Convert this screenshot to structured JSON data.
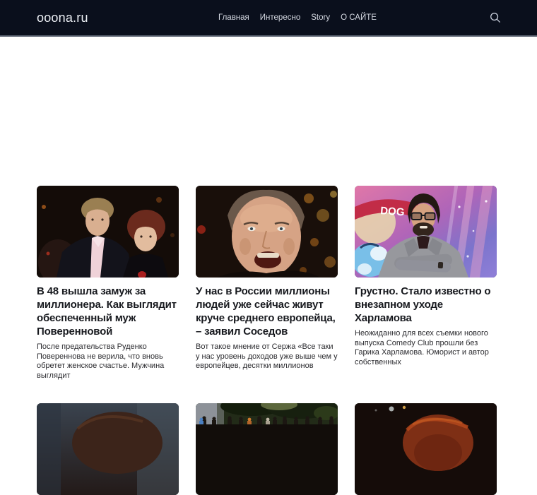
{
  "header": {
    "logo": "ooona.ru",
    "background_color": "#0a0f1c",
    "border_color": "#5c6472",
    "nav_items": [
      {
        "label": "Главная"
      },
      {
        "label": "Интересно"
      },
      {
        "label": "Story"
      },
      {
        "label": "О САЙТЕ"
      }
    ],
    "search_icon": "search-icon"
  },
  "articles": [
    {
      "title": "В 48 вышла замуж за миллионера. Как выглядит обеспеченный муж Поверенновой",
      "excerpt": "После предательства Руденко Повереннова не верила, что вновь обретет женское счастье. Мужчина выглядит",
      "image": "couple-man-in-suit-and-red-haired-woman-at-dark-event"
    },
    {
      "title": "У нас в России миллионы людей уже сейчас живут круче среднего европейца, – заявил Соседов",
      "excerpt": "Вот такое мнение от Сержа «Все таки у нас уровень доходов уже выше чем у европейцев, десятки миллионов",
      "image": "closeup-talking-man-face-warm-bokeh-lights"
    },
    {
      "title": "Грустно. Стало известно о внезапном уходе Харламова",
      "excerpt": "Неожиданно для всех съемки нового выпуска Comedy Club прошли без Гарика Харламова. Юморист и автор собственных",
      "image": "bearded-man-glasses-gray-blazer-colorful-backdrop",
      "image_text": "DOG"
    }
  ],
  "more_articles": [
    {
      "image": "top-of-brown-haired-head-dark-blue-background"
    },
    {
      "image": "outdoor-crowd-under-trees"
    },
    {
      "image": "curly-red-haired-person-dark-background"
    }
  ],
  "colors": {
    "title_text": "#17191e",
    "excerpt_text": "#2b2b2f",
    "nav_text": "#d5d9e2",
    "page_background": "#ffffff"
  }
}
